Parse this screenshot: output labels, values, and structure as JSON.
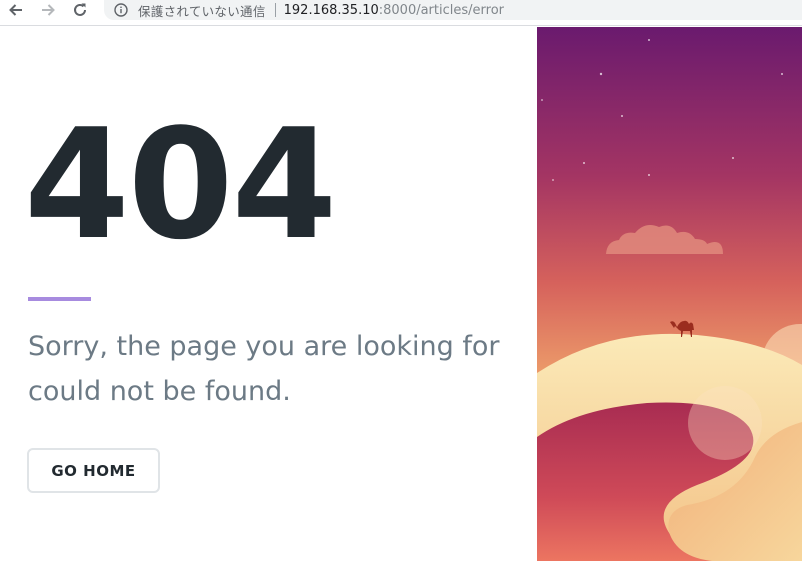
{
  "browser": {
    "security_label": "保護されていない通信",
    "url_host": "192.168.35.10",
    "url_rest": ":8000/articles/error"
  },
  "page": {
    "error_code": "404",
    "message": "Sorry, the page you are looking for could not be found.",
    "home_button_label": "GO HOME"
  },
  "colors": {
    "accent": "#a78bdf",
    "heading": "#222a30",
    "message": "#6c7a85"
  }
}
